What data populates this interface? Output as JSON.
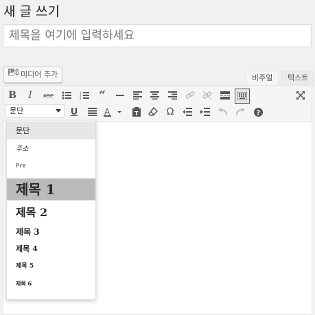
{
  "page": {
    "title": "새 글 쓰기"
  },
  "title_field": {
    "placeholder": "제목을 여기에 입력하세요"
  },
  "media": {
    "add_label": "미디어 추가",
    "icon": "add-media-icon"
  },
  "editor_tabs": [
    {
      "label": "비주얼",
      "active": true
    },
    {
      "label": "텍스트",
      "active": false
    }
  ],
  "toolbar": {
    "row1": [
      "bold",
      "italic",
      "strikethrough",
      "bulleted-list",
      "numbered-list",
      "blockquote",
      "horizontal-line",
      "align-left",
      "align-center",
      "align-right",
      "insert-link",
      "remove-link",
      "read-more",
      "toolbar-toggle",
      "fullscreen"
    ],
    "row2": [
      "underline",
      "justify",
      "text-color",
      "paste-as-text",
      "clear-formatting",
      "special-character",
      "decrease-indent",
      "increase-indent",
      "undo",
      "redo",
      "help"
    ],
    "format_select": {
      "value": "문단"
    }
  },
  "format_dropdown": {
    "items": [
      {
        "label": "문단",
        "selected": false,
        "hovered": true
      },
      {
        "label": "주소"
      },
      {
        "label": "Pre"
      },
      {
        "label": "제목 1",
        "selected": true
      },
      {
        "label": "제목 2"
      },
      {
        "label": "제목 3"
      },
      {
        "label": "제목 4"
      },
      {
        "label": "제목 5"
      },
      {
        "label": "제목 6"
      }
    ]
  },
  "colors": {
    "selected_item_bg": "#bbbbbb",
    "hover_item_bg": "#e6e6e6",
    "page_bg": "#f1f1f1"
  }
}
